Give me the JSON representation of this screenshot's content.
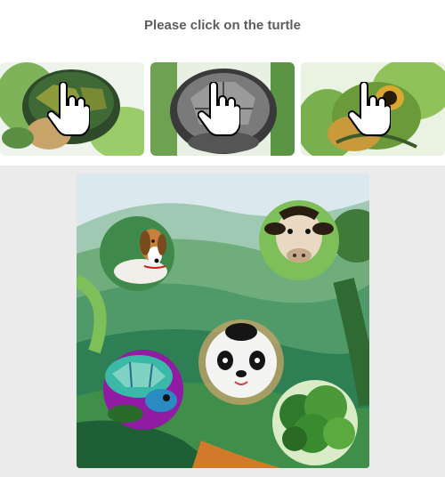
{
  "prompt": {
    "text": "Please click on the turtle"
  },
  "examples": [
    {
      "subject": "turtle",
      "cursor_icon": "hand-pointer-icon"
    },
    {
      "subject": "turtle",
      "cursor_icon": "hand-pointer-icon"
    },
    {
      "subject": "turtle",
      "cursor_icon": "hand-pointer-icon"
    }
  ],
  "scene": {
    "targets": [
      "beagle",
      "cow",
      "turtle",
      "panda",
      "broccoli"
    ],
    "colors": {
      "background": "#ebebeb",
      "title": "#5e5e5e"
    }
  }
}
